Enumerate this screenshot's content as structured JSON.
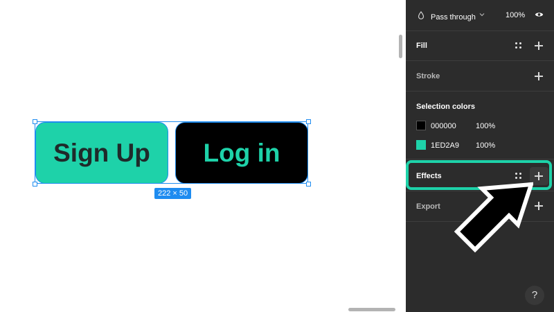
{
  "canvas": {
    "buttons": [
      {
        "label": "Sign Up"
      },
      {
        "label": "Log in"
      }
    ],
    "size_badge": "222 × 50"
  },
  "panel": {
    "layer": {
      "blend_mode": "Pass through",
      "opacity": "100%"
    },
    "fill": {
      "title": "Fill"
    },
    "stroke": {
      "title": "Stroke"
    },
    "selection_colors": {
      "title": "Selection colors",
      "items": [
        {
          "hex": "000000",
          "opacity": "100%",
          "color": "#000000"
        },
        {
          "hex": "1ED2A9",
          "opacity": "100%",
          "color": "#1ED2A9"
        }
      ]
    },
    "effects": {
      "title": "Effects"
    },
    "export": {
      "title": "Export"
    },
    "help": "?"
  },
  "colors": {
    "accent": "#1ED2A9",
    "selection": "#1E8CF0",
    "panel_bg": "#2C2C2C"
  },
  "icons": [
    "drop-icon",
    "chevron-down-icon",
    "eye-icon",
    "style-dots-icon",
    "plus-icon",
    "cursor-arrow-icon",
    "help-icon"
  ]
}
